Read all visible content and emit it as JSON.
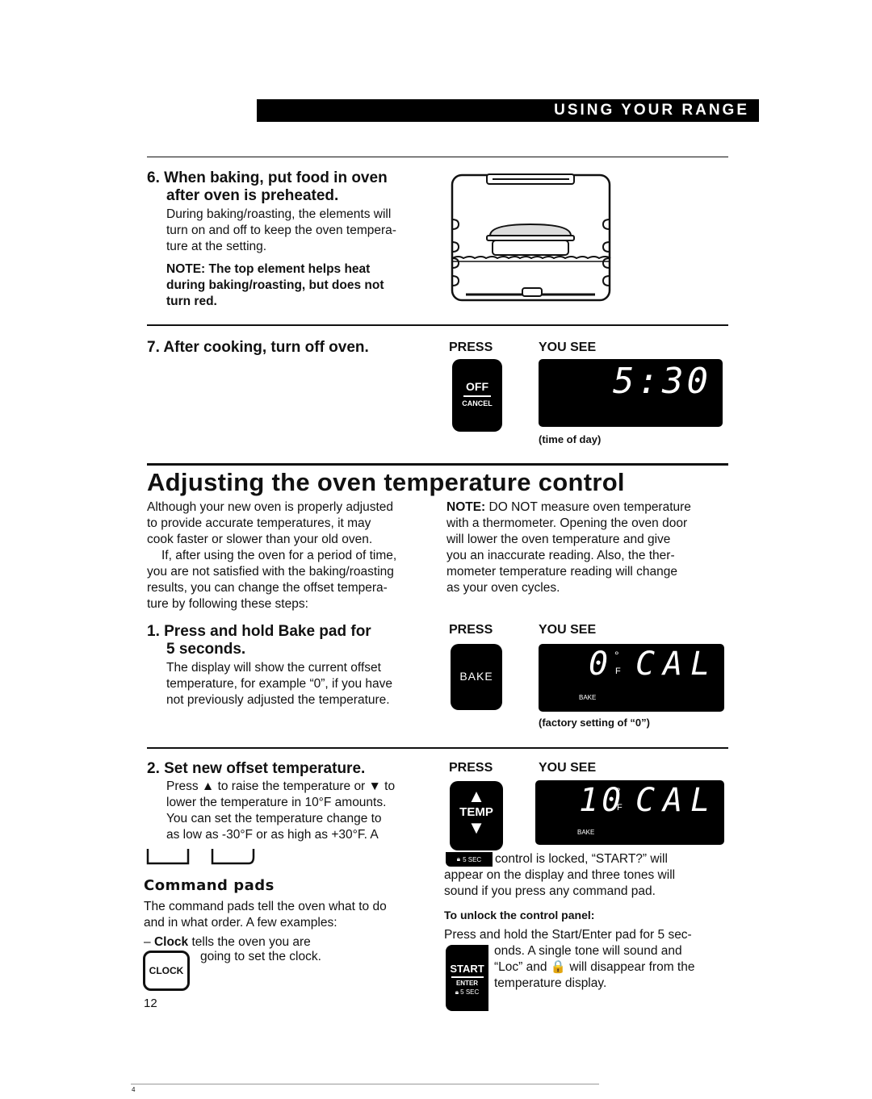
{
  "header": {
    "section_banner": "USING YOUR RANGE"
  },
  "step6": {
    "number": "6.",
    "title_line1": "When baking, put food in oven",
    "title_line2": "after oven is preheated.",
    "body": [
      "During baking/roasting, the elements will",
      "turn on and off to keep the oven tempera-",
      "ture at the setting."
    ],
    "note": [
      "NOTE: The top element helps heat",
      "during baking/roasting, but does not",
      "turn red."
    ],
    "illustration": "oven-interior-with-pan-icon"
  },
  "step7": {
    "title": "7. After cooking, turn off oven.",
    "press_label": "PRESS",
    "you_see_label": "YOU SEE",
    "pad_top": "OFF",
    "pad_bottom": "CANCEL",
    "display": "5:30",
    "caption": "(time of day)"
  },
  "section": {
    "title": "Adjusting the oven temperature control",
    "intro_left": [
      "Although your new oven is properly adjusted",
      "to provide accurate temperatures, it may",
      "cook faster or slower than your old oven.",
      "If, after using the oven for a period of time,",
      "you are not satisfied with the baking/roasting",
      "results, you can change the offset tempera-",
      "ture by following these steps:"
    ],
    "note_label": "NOTE:",
    "note_right": [
      " DO NOT measure oven temperature",
      "with a thermometer. Opening the oven door",
      "will lower the oven temperature and give",
      "you an inaccurate reading. Also, the ther-",
      "mometer temperature reading will change",
      "as your oven cycles."
    ]
  },
  "step1": {
    "title_line1": "1. Press and hold Bake pad for",
    "title_line2": "5 seconds.",
    "body": [
      "The display will show the current offset",
      "temperature, for example “0”, if you have",
      "not previously adjusted the temperature."
    ],
    "press_label": "PRESS",
    "you_see_label": "YOU SEE",
    "pad": "BAKE",
    "display_value": "0",
    "display_unit_deg": "°",
    "display_unit_f": "F",
    "display_text": "CAL",
    "display_mode": "BAKE",
    "caption": "(factory setting of “0”)"
  },
  "step2": {
    "title": "2. Set new offset temperature.",
    "body": [
      "Press ▲ to raise the temperature or ▼ to",
      "lower the temperature in 10°F amounts.",
      "You can set the temperature change to",
      "as low as -30°F or as high as +30°F. A"
    ],
    "press_label": "PRESS",
    "you_see_label": "YOU SEE",
    "pad_up": "▲",
    "pad_label": "TEMP",
    "pad_down": "▼",
    "display_value": "10",
    "display_unit_deg": "°",
    "display_unit_f": "F",
    "display_text": "CAL",
    "display_mode": "BAKE"
  },
  "locked": {
    "badge": "5 SEC",
    "lines": [
      "control is locked, “START?” will",
      "appear on the display and three tones will",
      "sound if you press any command pad."
    ]
  },
  "unlock": {
    "title": "To unlock the control panel:",
    "line1": "Press and hold the Start/Enter pad for 5 sec-",
    "lines": [
      "onds. A single tone will sound and",
      "“Loc” and 🔒 will disappear from the",
      "temperature display."
    ],
    "pad_top": "START",
    "pad_mid": "ENTER",
    "pad_bottom": "5 SEC"
  },
  "command_pads": {
    "title": "Command pads",
    "body": [
      "The command pads tell the oven what to do",
      "and in what order. A few examples:"
    ],
    "clock_prefix": "– ",
    "clock_bold": "Clock",
    "clock_rest": " tells the oven you are",
    "clock_line2": "going to set the clock.",
    "clock_pad": "CLOCK"
  },
  "footer": {
    "page_number": "12",
    "corner_mark": "4"
  }
}
